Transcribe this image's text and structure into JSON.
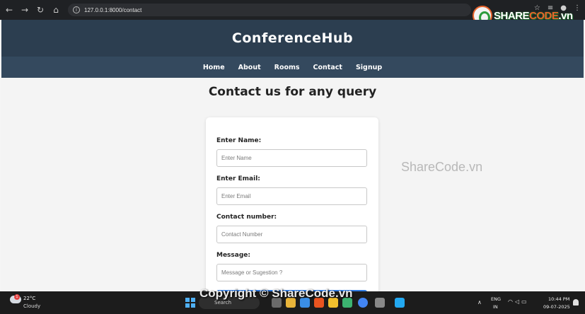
{
  "browser": {
    "url": "127.0.0.1:8000/contact",
    "back_icon": "arrow-left-icon",
    "forward_icon": "arrow-right-icon",
    "reload_icon": "reload-icon",
    "home_icon": "home-icon"
  },
  "watermark": {
    "logo_share": "SHARE",
    "logo_code": "CODE",
    "logo_vn": ".vn",
    "center_text": "ShareCode.vn",
    "copyright_text": "Copyright © ShareCode.vn"
  },
  "site": {
    "brand": "ConferenceHub",
    "nav": [
      {
        "label": "Home"
      },
      {
        "label": "About"
      },
      {
        "label": "Rooms"
      },
      {
        "label": "Contact"
      },
      {
        "label": "Signup"
      }
    ],
    "header_bg": "#2c3e50",
    "nav_bg": "#34495e"
  },
  "page": {
    "title": "Contact us for any query"
  },
  "form": {
    "fields": [
      {
        "label": "Enter Name:",
        "placeholder": "Enter Name",
        "value": ""
      },
      {
        "label": "Enter Email:",
        "placeholder": "Enter Email",
        "value": ""
      },
      {
        "label": "Contact number:",
        "placeholder": "Contact Number",
        "value": ""
      },
      {
        "label": "Message:",
        "placeholder": "Message or Sugestion ?",
        "value": ""
      }
    ],
    "submit_color": "#2f7be4"
  },
  "taskbar": {
    "weather_temp": "22°C",
    "weather_condition": "Cloudy",
    "weather_badge": "1",
    "search_label": "Search",
    "lang_line1": "ENG",
    "lang_line2": "IN",
    "time": "10:44 PM",
    "date": "09-07-2025"
  }
}
